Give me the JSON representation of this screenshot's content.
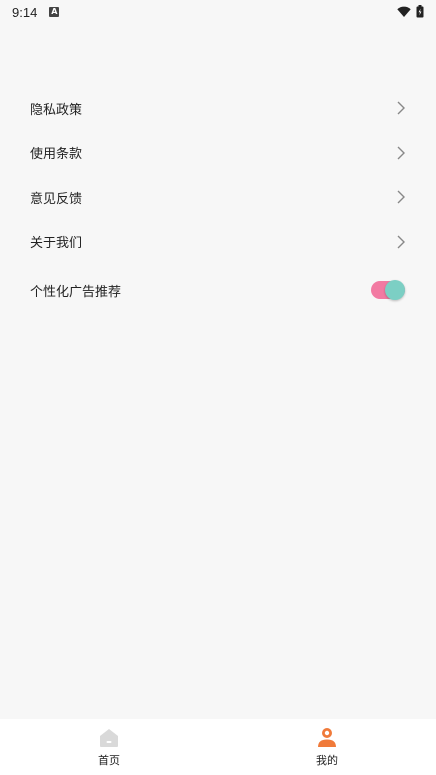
{
  "status_bar": {
    "time": "9:14",
    "notification_icon_letter": "A"
  },
  "menu": {
    "items": [
      {
        "label": "隐私政策",
        "icon": "chevron-right-icon"
      },
      {
        "label": "使用条款",
        "icon": "chevron-right-icon"
      },
      {
        "label": "意见反馈",
        "icon": "chevron-right-icon"
      },
      {
        "label": "关于我们",
        "icon": "chevron-right-icon"
      }
    ],
    "toggle_item": {
      "label": "个性化广告推荐",
      "enabled": true
    }
  },
  "bottom_nav": {
    "items": [
      {
        "label": "首页",
        "icon": "home-icon",
        "active": false
      },
      {
        "label": "我的",
        "icon": "profile-icon",
        "active": true
      }
    ]
  },
  "colors": {
    "background": "#f7f7f7",
    "toggle_track": "#f27aa2",
    "toggle_knob": "#7ccfc4",
    "active_nav_icon": "#f07a3a",
    "inactive_nav_icon": "#d9d9d9",
    "chevron": "#888888"
  }
}
